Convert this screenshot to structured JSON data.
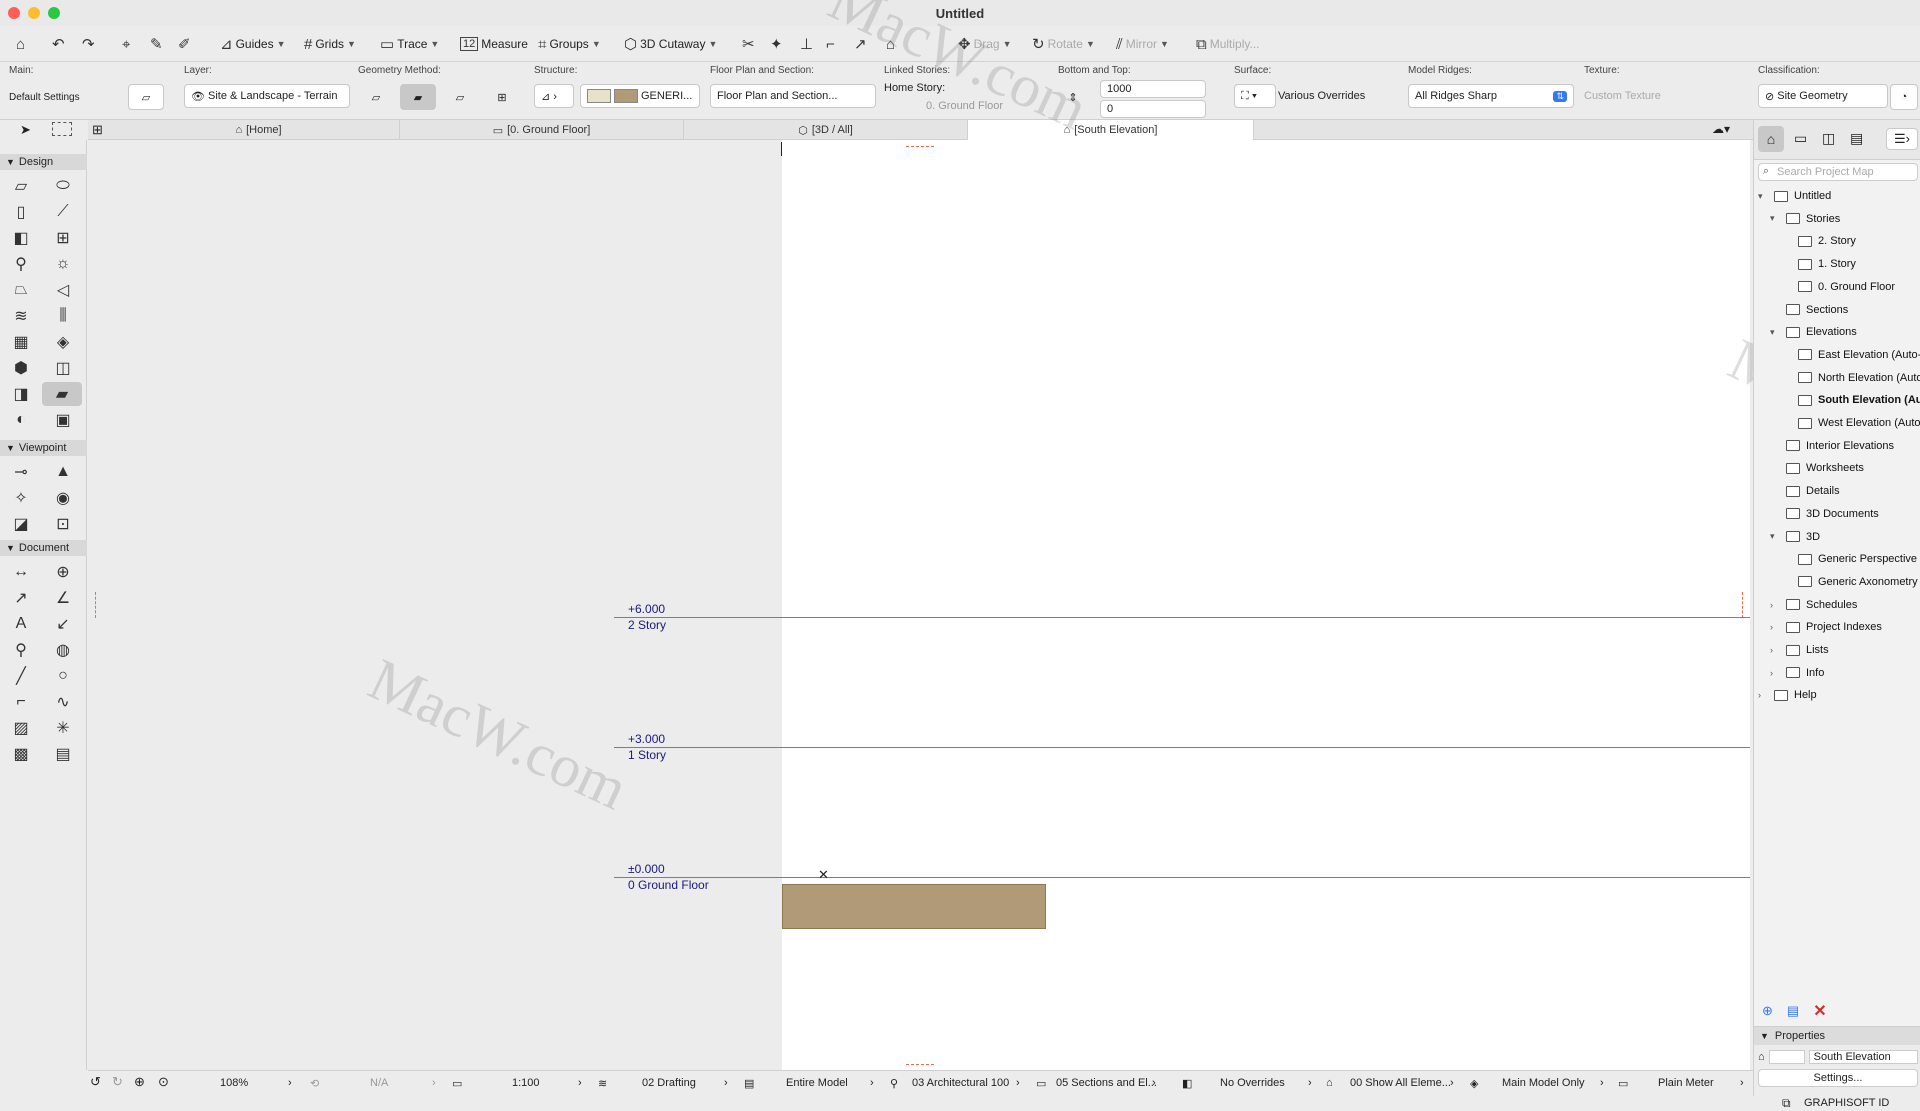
{
  "window": {
    "title": "Untitled"
  },
  "toolbar": {
    "guides": "Guides",
    "grids": "Grids",
    "trace": "Trace",
    "measure": "Measure",
    "groups": "Groups",
    "cutaway": "3D Cutaway",
    "drag": "Drag",
    "rotate": "Rotate",
    "mirror": "Mirror",
    "multiply": "Multiply..."
  },
  "infobox": {
    "main_label": "Main:",
    "main_value": "Default Settings",
    "layer_label": "Layer:",
    "layer_value": "Site & Landscape - Terrain",
    "geometry_label": "Geometry Method:",
    "structure_label": "Structure:",
    "structure_value": "GENERI...",
    "fps_label": "Floor Plan and Section:",
    "fps_value": "Floor Plan and Section...",
    "linked_label": "Linked Stories:",
    "home_story_label": "Home Story:",
    "home_story_value": "0. Ground Floor",
    "bt_label": "Bottom and Top:",
    "bt_top": "1000",
    "bt_bottom": "0",
    "surface_label": "Surface:",
    "surface_value": "Various Overrides",
    "ridges_label": "Model Ridges:",
    "ridges_value": "All Ridges Sharp",
    "texture_label": "Texture:",
    "texture_value": "Custom Texture",
    "class_label": "Classification:",
    "class_value": "Site Geometry"
  },
  "tabs": [
    "[Home]",
    "[0. Ground Floor]",
    "[3D / All]",
    "[South Elevation]"
  ],
  "toolbox": {
    "design": "Design",
    "viewpoint": "Viewpoint",
    "document": "Document"
  },
  "levels": [
    {
      "value": "+6.000",
      "name": "2 Story"
    },
    {
      "value": "+3.000",
      "name": "1 Story"
    },
    {
      "value": "±0.000",
      "name": "0 Ground Floor"
    }
  ],
  "statusbar": {
    "zoom": "108%",
    "na": "N/A",
    "scale": "1:100",
    "layer_combo": "02 Drafting",
    "model": "Entire Model",
    "pen_set": "03 Architectural 100",
    "mvo": "05 Sections and El...",
    "overrides": "No Overrides",
    "renovation": "00 Show All Eleme...",
    "structure": "Main Model Only",
    "dimension": "Plain Meter"
  },
  "navigator": {
    "search_placeholder": "Search Project Map",
    "items": [
      {
        "label": "Untitled",
        "level": 0,
        "tw": "v",
        "bold": false
      },
      {
        "label": "Stories",
        "level": 1,
        "tw": "v",
        "bold": false
      },
      {
        "label": "2. Story",
        "level": 2,
        "tw": "",
        "bold": false
      },
      {
        "label": "1. Story",
        "level": 2,
        "tw": "",
        "bold": false
      },
      {
        "label": "0. Ground Floor",
        "level": 2,
        "tw": "",
        "bold": false
      },
      {
        "label": "Sections",
        "level": 1,
        "tw": "",
        "bold": false
      },
      {
        "label": "Elevations",
        "level": 1,
        "tw": "v",
        "bold": false
      },
      {
        "label": "East Elevation (Auto-",
        "level": 2,
        "tw": "",
        "bold": false
      },
      {
        "label": "North Elevation (Auto",
        "level": 2,
        "tw": "",
        "bold": false
      },
      {
        "label": "South Elevation (Au",
        "level": 2,
        "tw": "",
        "bold": true
      },
      {
        "label": "West Elevation (Auto",
        "level": 2,
        "tw": "",
        "bold": false
      },
      {
        "label": "Interior Elevations",
        "level": 1,
        "tw": "",
        "bold": false
      },
      {
        "label": "Worksheets",
        "level": 1,
        "tw": "",
        "bold": false
      },
      {
        "label": "Details",
        "level": 1,
        "tw": "",
        "bold": false
      },
      {
        "label": "3D Documents",
        "level": 1,
        "tw": "",
        "bold": false
      },
      {
        "label": "3D",
        "level": 1,
        "tw": "v",
        "bold": false
      },
      {
        "label": "Generic Perspective",
        "level": 2,
        "tw": "",
        "bold": false
      },
      {
        "label": "Generic Axonometry",
        "level": 2,
        "tw": "",
        "bold": false
      },
      {
        "label": "Schedules",
        "level": 1,
        "tw": ">",
        "bold": false
      },
      {
        "label": "Project Indexes",
        "level": 1,
        "tw": ">",
        "bold": false
      },
      {
        "label": "Lists",
        "level": 1,
        "tw": ">",
        "bold": false
      },
      {
        "label": "Info",
        "level": 1,
        "tw": ">",
        "bold": false
      },
      {
        "label": "Help",
        "level": 0,
        "tw": ">",
        "bold": false
      }
    ],
    "properties_title": "Properties",
    "properties_value": "South Elevation",
    "settings_button": "Settings...",
    "graphisoft_id": "GRAPHISOFT ID"
  },
  "watermark": "MacW.com",
  "colors": {
    "slab": "#b09a78",
    "level_line": "#5a82c8",
    "level_text": "#1a1a7a"
  }
}
